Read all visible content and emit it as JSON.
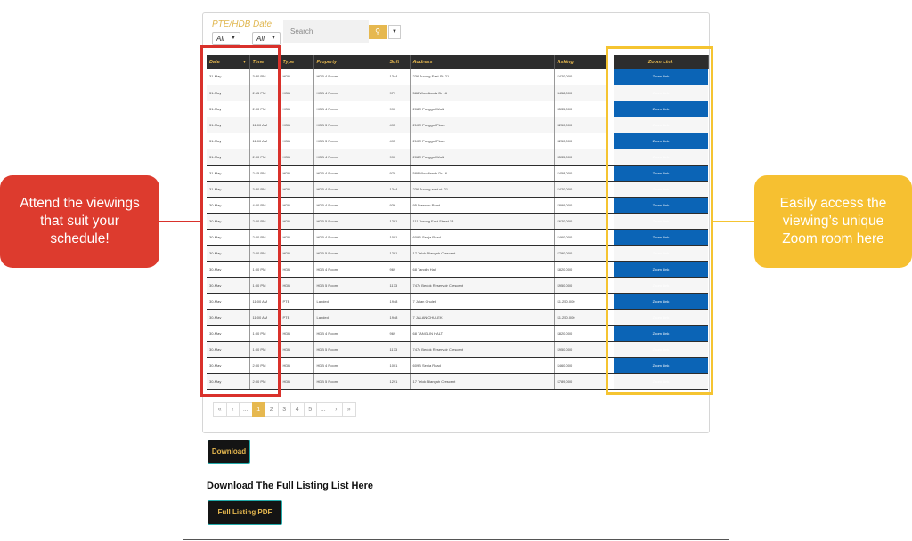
{
  "filters": {
    "type_label": "PTE/HDB",
    "date_label": "Date",
    "type_value": "All",
    "date_value": "All",
    "search_placeholder": "Search"
  },
  "table": {
    "headers": [
      "Date",
      "Time",
      "Type",
      "Property",
      "Sqft",
      "Address",
      "Asking",
      "Zoom Link"
    ],
    "zoom_label": "Zoom Link",
    "rows": [
      [
        "31-May",
        "3:30 PM",
        "HDB",
        "HDB 4 Room",
        "1344",
        "236 Jurong East St. 21",
        "$420,000"
      ],
      [
        "31-May",
        "2:15 PM",
        "HDB",
        "HDB 4 Room",
        "979",
        "588 Woodlands Dr 16",
        "$458,000"
      ],
      [
        "31-May",
        "2:00 PM",
        "HDB",
        "HDB 4 Room",
        "990",
        "208C Punggol Walk",
        "$535,000"
      ],
      [
        "31-May",
        "11:00 AM",
        "HDB",
        "HDB 3 Room",
        "495",
        "210C Punggol Place",
        "$250,000"
      ],
      [
        "31-May",
        "11:00 AM",
        "HDB",
        "HDB 3 Room",
        "495",
        "210C Punggol Place",
        "$250,000"
      ],
      [
        "31-May",
        "2:00 PM",
        "HDB",
        "HDB 4 Room",
        "990",
        "208C Punggol Walk",
        "$535,000"
      ],
      [
        "31-May",
        "2:15 PM",
        "HDB",
        "HDB 4 Room",
        "979",
        "588 Woodlands Dr 16",
        "$458,000"
      ],
      [
        "31-May",
        "3:30 PM",
        "HDB",
        "HDB 4 Room",
        "1344",
        "236 Jurong east st. 21",
        "$420,000"
      ],
      [
        "30-May",
        "4:00 PM",
        "HDB",
        "HDB 4 Room",
        "936",
        "95 Dawson Road",
        "$899,000"
      ],
      [
        "30-May",
        "2:00 PM",
        "HDB",
        "HDB 5 Room",
        "1291",
        "111 Jurong East Street 13",
        "$620,000"
      ],
      [
        "30-May",
        "2:00 PM",
        "HDB",
        "HDB 4 Room",
        "1001",
        "609B Senja Road",
        "$460,000"
      ],
      [
        "30-May",
        "2:00 PM",
        "HDB",
        "HDB 5 Room",
        "1291",
        "17 Telok Blangah Crescent",
        "$790,000"
      ],
      [
        "30-May",
        "1:00 PM",
        "HDB",
        "HDB 4 Room",
        "969",
        "68 Tanglin Halt",
        "$820,000"
      ],
      [
        "30-May",
        "1:00 PM",
        "HDB",
        "HDB 5 Room",
        "1173",
        "747c Bedok Reservoir Crescent",
        "$950,000"
      ],
      [
        "30-May",
        "11:00 AM",
        "PTE",
        "Landed",
        "1948",
        "7 Jalan Chulek",
        "$1,250,000"
      ],
      [
        "30-May",
        "11:00 AM",
        "PTE",
        "Landed",
        "1948",
        "7 JALAN CHULEK",
        "$1,250,000"
      ],
      [
        "30-May",
        "1:00 PM",
        "HDB",
        "HDB 4 Room",
        "969",
        "68 TANGLIN HALT",
        "$820,000"
      ],
      [
        "30-May",
        "1:00 PM",
        "HDB",
        "HDB 5 Room",
        "1173",
        "747c Bedok Reservoir Crescent",
        "$950,000"
      ],
      [
        "30-May",
        "2:00 PM",
        "HDB",
        "HDB 4 Room",
        "1001",
        "609B Senja Road",
        "$460,000"
      ],
      [
        "30-May",
        "2:00 PM",
        "HDB",
        "HDB 5 Room",
        "1291",
        "17 Telok Blangah Crescent",
        "$789,000"
      ]
    ]
  },
  "pagination": [
    "«",
    "‹",
    "...",
    "1",
    "2",
    "3",
    "4",
    "5",
    "...",
    "›",
    "»"
  ],
  "pagination_active": "1",
  "download_label": "Download",
  "full_listing_heading": "Download The Full Listing List Here",
  "full_listing_button": "Full Listing PDF",
  "callouts": {
    "left": "Attend the viewings that suit your schedule!",
    "right": "Easily access the viewing’s unique Zoom room here"
  },
  "colors": {
    "accent_gold": "#e6b84f",
    "header_dark": "#2d2d2d",
    "zoom_blue": "#0b64b6",
    "callout_red": "#dd3b2e",
    "callout_yellow": "#f6c031"
  }
}
